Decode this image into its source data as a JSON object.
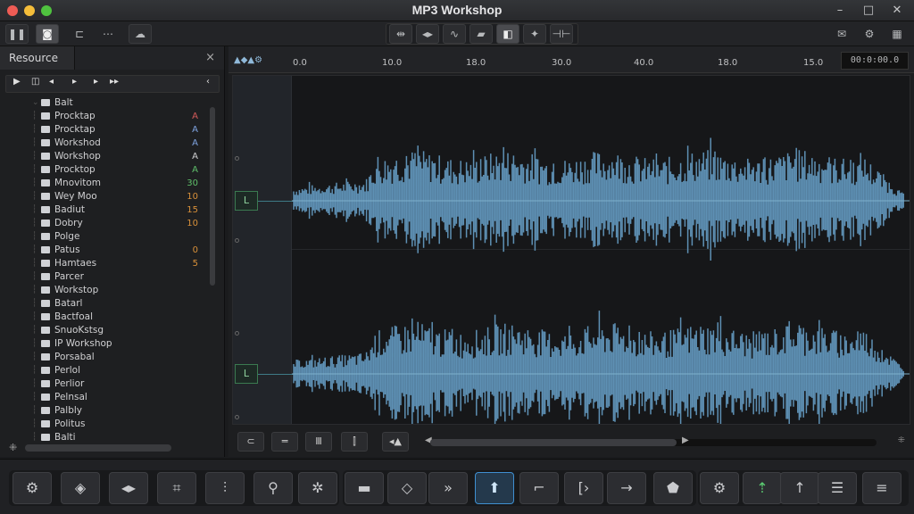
{
  "window": {
    "title": "MP3 Workshop",
    "controls": [
      "minimize-icon",
      "maximize-icon",
      "close-icon"
    ]
  },
  "toolbar": {
    "left": [
      "pause-icon",
      "record-icon",
      "align-icon",
      "dash-icon",
      "cloud-icon"
    ],
    "center": [
      "split-icon",
      "nudge-icon",
      "wave-icon",
      "comment-icon",
      "select-icon",
      "sparkle-icon",
      "trim-icon"
    ],
    "right": [
      "mail-icon",
      "gear-icon"
    ]
  },
  "panel": {
    "title": "Resource",
    "close_label": "×",
    "items": [
      {
        "label": "Balt",
        "value": ""
      },
      {
        "label": "Procktap",
        "value": "A",
        "tone": "red"
      },
      {
        "label": "Procktap",
        "value": "A",
        "tone": "blue"
      },
      {
        "label": "Workshod",
        "value": "A",
        "tone": "blue"
      },
      {
        "label": "Workshop",
        "value": "A",
        "tone": "plain"
      },
      {
        "label": "Procktop",
        "value": "A",
        "tone": "green"
      },
      {
        "label": "Mnovitom",
        "value": "30",
        "tone": "green"
      },
      {
        "label": "Wey Moo",
        "value": "10",
        "tone": "orange"
      },
      {
        "label": "Badiut",
        "value": "15",
        "tone": "orange"
      },
      {
        "label": "Dobry",
        "value": "10",
        "tone": "orange"
      },
      {
        "label": "Polge",
        "value": ""
      },
      {
        "label": "Patus",
        "value": "0",
        "tone": "orange"
      },
      {
        "label": "Hamtaes",
        "value": "5",
        "tone": "orange"
      },
      {
        "label": "Parcer",
        "value": ""
      },
      {
        "label": "Workstop",
        "value": ""
      },
      {
        "label": "Batarl",
        "value": ""
      },
      {
        "label": "Bactfoal",
        "value": ""
      },
      {
        "label": "SnuoKstsg",
        "value": ""
      },
      {
        "label": "IP Workshop",
        "value": ""
      },
      {
        "label": "Porsabal",
        "value": ""
      },
      {
        "label": "Perlol",
        "value": ""
      },
      {
        "label": "Perlior",
        "value": ""
      },
      {
        "label": "Pelnsal",
        "value": ""
      },
      {
        "label": "Palbly",
        "value": ""
      },
      {
        "label": "Politus",
        "value": ""
      },
      {
        "label": "Balti",
        "value": ""
      }
    ]
  },
  "ruler": {
    "ticks": [
      "0.0",
      "10.0",
      "18.0",
      "30.0",
      "40.0",
      "18.0",
      "15.0"
    ],
    "time_display": "00:0:00.0"
  },
  "tracks": [
    {
      "button_label": "L"
    },
    {
      "button_label": "L"
    }
  ],
  "edit_bar": {
    "buttons": [
      "loop-icon",
      "equal-icon",
      "bars-icon",
      "level-icon",
      "volume-icon"
    ]
  },
  "bottom_toolbar": {
    "buttons": [
      "gear-icon",
      "shield-icon",
      "stretch-icon",
      "crop-icon",
      "tune-icon",
      "pin-icon",
      "cog-icon",
      "frame-icon",
      "diamond-icon",
      "forward-icon",
      "import-icon",
      "fade-icon",
      "bracket-icon",
      "arrow-icon",
      "drop-icon",
      "settings-icon",
      "pitch-icon",
      "up-icon",
      "list-icon",
      "menu-icon"
    ]
  },
  "colors": {
    "waveform": "#5e90b4",
    "accent": "#3f8fd0",
    "track_button": "#3b7a50"
  }
}
